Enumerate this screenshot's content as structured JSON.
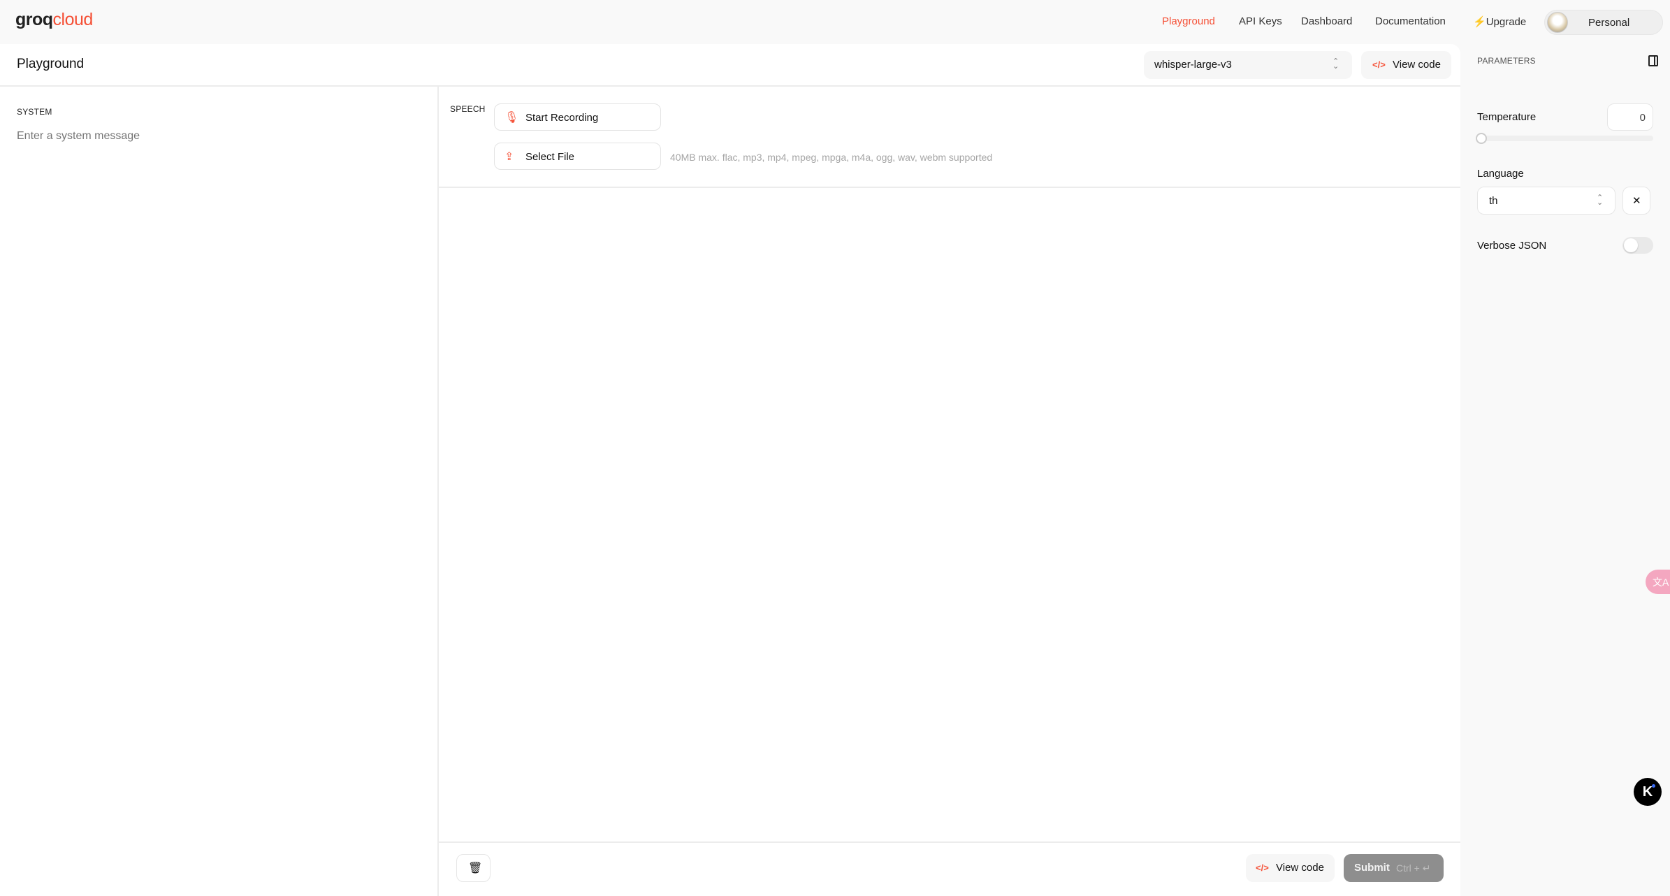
{
  "header": {
    "logo": {
      "part1": "groq",
      "part2": "cloud"
    },
    "nav": [
      {
        "label": "Playground",
        "active": true
      },
      {
        "label": "API Keys"
      },
      {
        "label": "Dashboard"
      },
      {
        "label": "Documentation"
      },
      {
        "label": "Upgrade",
        "icon": "lightning-icon"
      }
    ],
    "account": {
      "label": "Personal"
    }
  },
  "main": {
    "title": "Playground",
    "model": "whisper-large-v3",
    "view_code": "View code",
    "system": {
      "label": "SYSTEM",
      "placeholder": "Enter a system message"
    },
    "speech": {
      "label": "SPEECH",
      "start_recording": "Start Recording",
      "select_file": "Select File",
      "hint": "40MB max. flac, mp3, mp4, mpeg, mpga, m4a, ogg, wav, webm supported"
    },
    "footer": {
      "view_code": "View code",
      "submit": "Submit",
      "shortcut": "Ctrl + ↵"
    }
  },
  "parameters": {
    "title": "PARAMETERS",
    "temperature": {
      "label": "Temperature",
      "value": "0",
      "slider_fraction": 0
    },
    "language": {
      "label": "Language",
      "value": "th",
      "clear": "✕"
    },
    "verbose_json": {
      "label": "Verbose JSON",
      "enabled": false
    }
  },
  "colors": {
    "accent": "#f55036",
    "submit_disabled": "#8e8e8e"
  }
}
